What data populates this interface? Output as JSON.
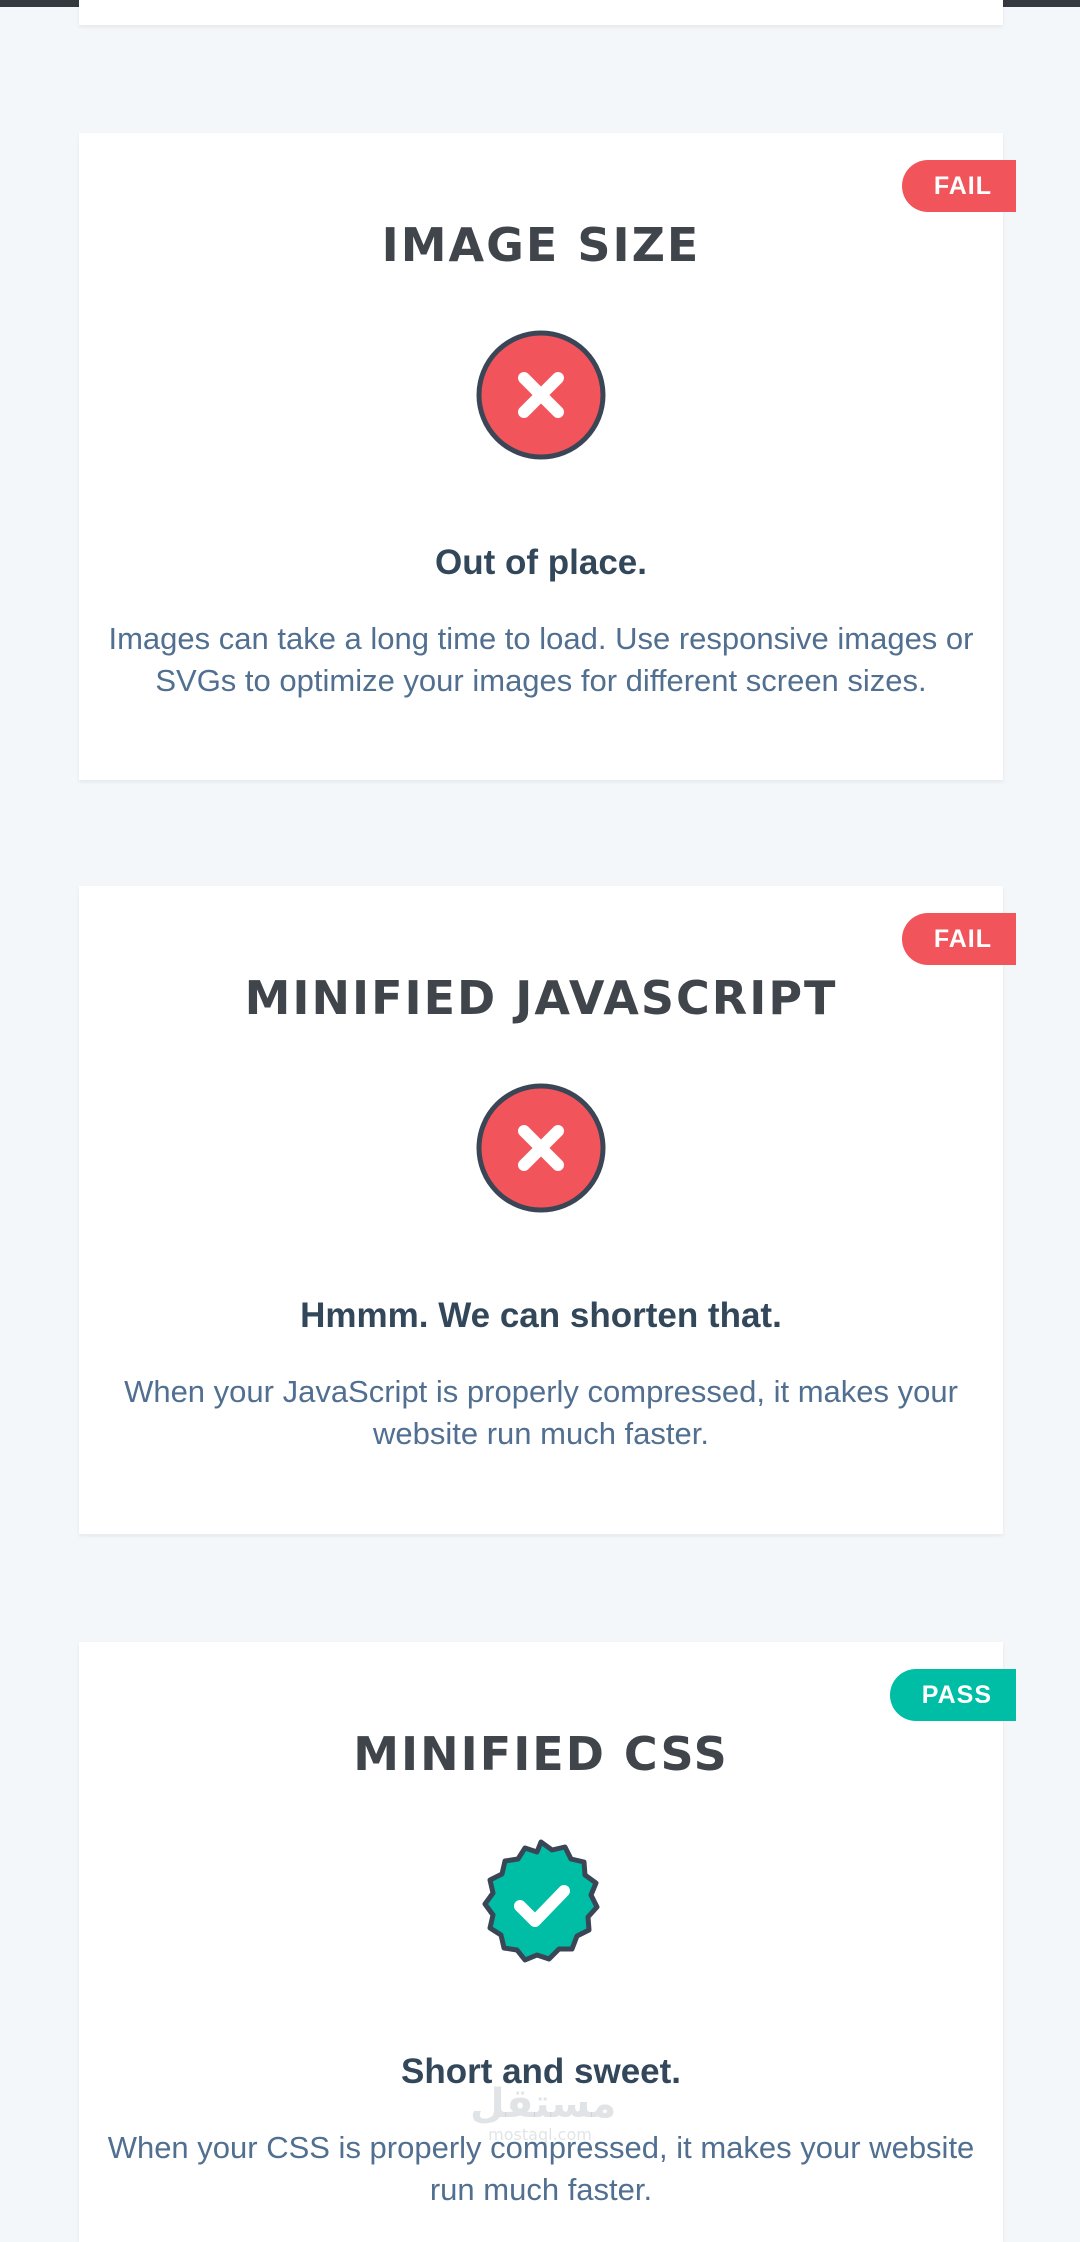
{
  "colors": {
    "fail": "#f2545b",
    "pass": "#00bda5",
    "title": "#3f454a",
    "subtitle": "#33475b",
    "description": "#516f90",
    "background": "#f4f7f9"
  },
  "cards": [
    {
      "status": "FAIL",
      "title": "IMAGE SIZE",
      "icon": "x-circle-icon",
      "subtitle": "Out of place.",
      "description": "Images can take a long time to load. Use responsive images or SVGs to optimize your images for different screen sizes."
    },
    {
      "status": "FAIL",
      "title": "MINIFIED JAVASCRIPT",
      "icon": "x-circle-icon",
      "subtitle": "Hmmm. We can shorten that.",
      "description": "When your JavaScript is properly compressed, it makes your website run much faster."
    },
    {
      "status": "PASS",
      "title": "MINIFIED CSS",
      "icon": "check-badge-icon",
      "subtitle": "Short and sweet.",
      "description": "When your CSS is properly compressed, it makes your website run much faster."
    }
  ],
  "watermark": {
    "arabic": "مستقل",
    "latin": "mostaql.com"
  }
}
